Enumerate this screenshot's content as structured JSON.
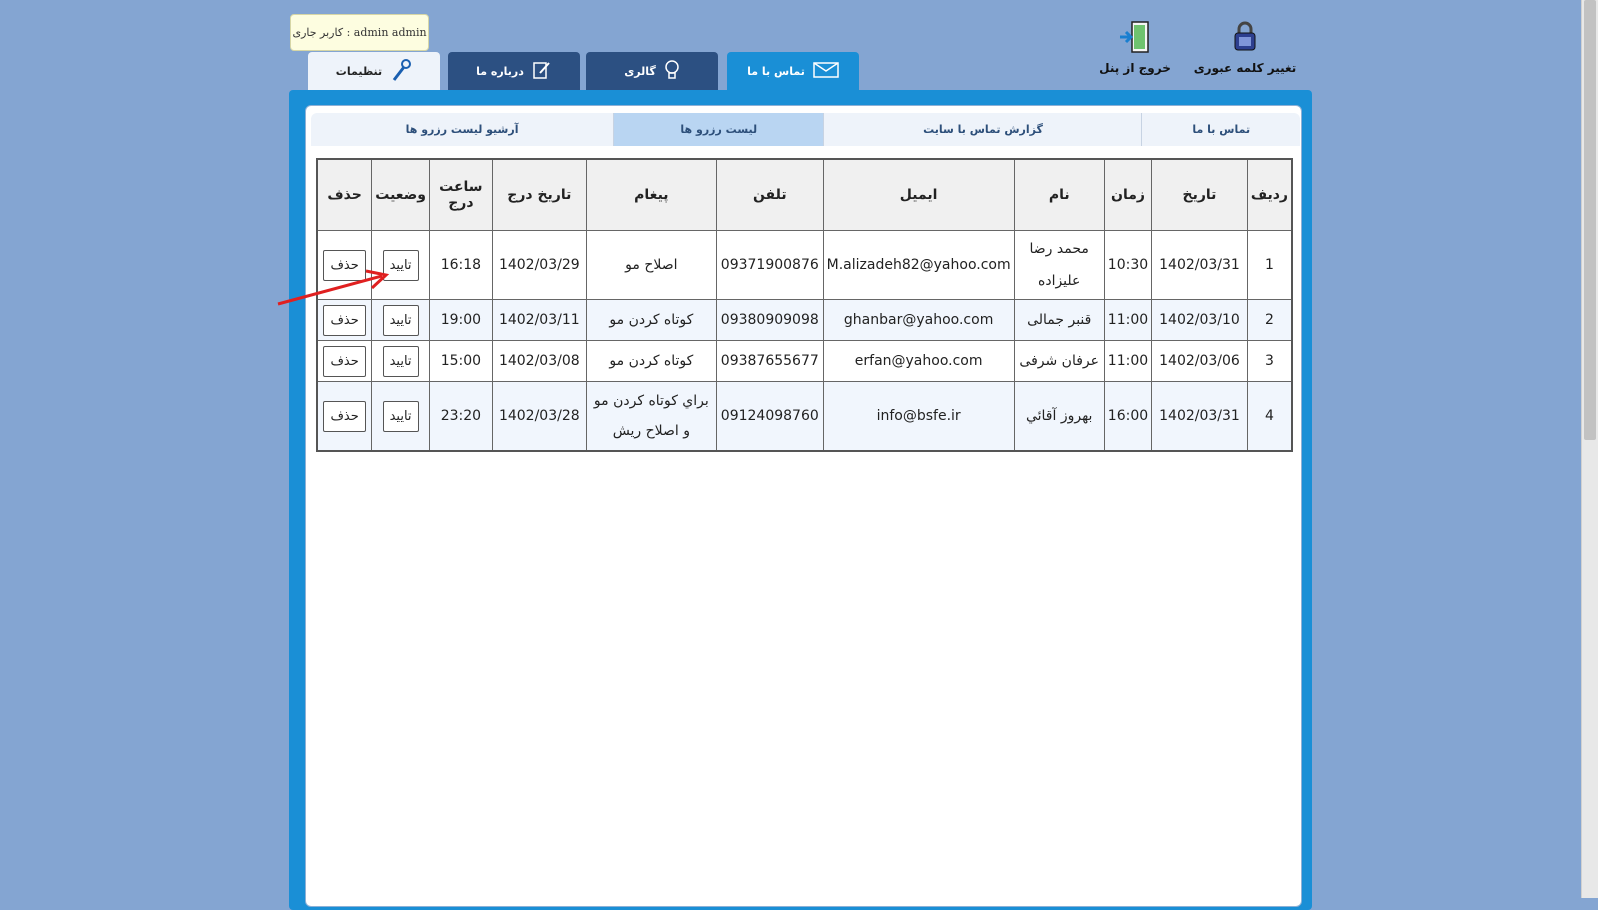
{
  "user": {
    "badge": "admin admin : کاربر جاری"
  },
  "header_actions": {
    "change_password": {
      "label": "تغییر کلمه عبوری",
      "icon": "lock-icon"
    },
    "logout": {
      "label": "خروج از پنل",
      "icon": "exit-door-icon"
    }
  },
  "main_tabs": [
    {
      "label": "تماس با ما",
      "icon": "envelope-icon",
      "state": "active"
    },
    {
      "label": "گالری",
      "icon": "lightbulb-icon",
      "state": "dark"
    },
    {
      "label": "درباره ما",
      "icon": "edit-note-icon",
      "state": "dark"
    },
    {
      "label": "تنظیمات",
      "icon": "wrench-icon",
      "state": "light"
    }
  ],
  "sub_tabs": [
    {
      "label": "تماس با ما"
    },
    {
      "label": "گزارش تماس با سایت"
    },
    {
      "label": "لیست رزرو ها",
      "selected": true
    },
    {
      "label": "آرشیو لیست رزرو ها"
    }
  ],
  "table": {
    "headers": {
      "row": "ردیف",
      "date": "تاریخ",
      "time": "زمان",
      "name": "نام",
      "email": "ایمیل",
      "phone": "تلفن",
      "message": "پیغام",
      "insert_date": "تاریخ درج",
      "insert_time": "ساعت درج",
      "status": "وضعیت",
      "delete": "حذف"
    },
    "rows": [
      {
        "row": "1",
        "date": "1402/03/31",
        "time": "10:30",
        "name": "محمد رضا علیزاده",
        "email": "M.alizadeh82@yahoo.com",
        "phone": "09371900876",
        "message": "اصلاح مو",
        "insert_date": "1402/03/29",
        "insert_time": "16:18",
        "status": "تایید",
        "delete": "حذف"
      },
      {
        "row": "2",
        "date": "1402/03/10",
        "time": "11:00",
        "name": "قنبر جمالی",
        "email": "ghanbar@yahoo.com",
        "phone": "09380909098",
        "message": "کوتاه کردن مو",
        "insert_date": "1402/03/11",
        "insert_time": "19:00",
        "status": "تایید",
        "delete": "حذف"
      },
      {
        "row": "3",
        "date": "1402/03/06",
        "time": "11:00",
        "name": "عرفان شرفی",
        "email": "erfan@yahoo.com",
        "phone": "09387655677",
        "message": "کوتاه کردن مو",
        "insert_date": "1402/03/08",
        "insert_time": "15:00",
        "status": "تایید",
        "delete": "حذف"
      },
      {
        "row": "4",
        "date": "1402/03/31",
        "time": "16:00",
        "name": "بهروز آقائي",
        "email": "info@bsfe.ir",
        "phone": "09124098760",
        "message": "براي كوتاه كردن مو و اصلاح ريش",
        "insert_date": "1402/03/28",
        "insert_time": "23:20",
        "status": "تایید",
        "delete": "حذف"
      }
    ]
  },
  "colors": {
    "background": "#84a5d2",
    "tab_active": "#1a8fd6",
    "tab_dark": "#2c5082",
    "annotation_arrow": "#e02020"
  }
}
